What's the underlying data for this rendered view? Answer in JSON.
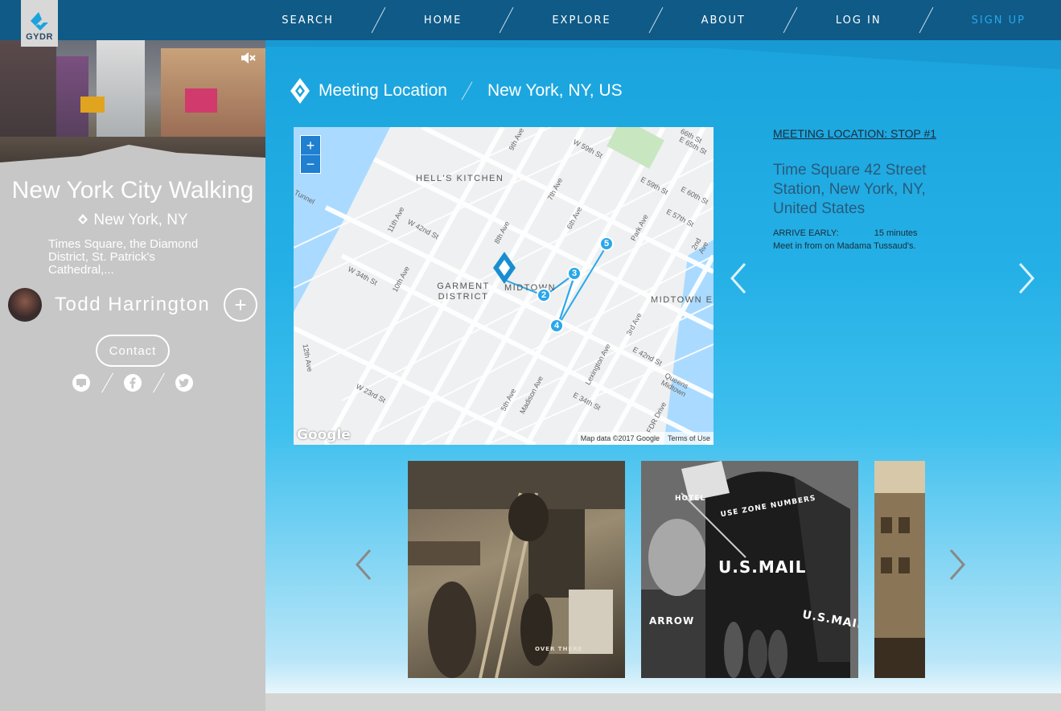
{
  "nav": {
    "logo_text": "GYDR",
    "items": [
      "SEARCH",
      "HOME",
      "EXPLORE",
      "ABOUT",
      "LOG IN",
      "SIGN UP"
    ]
  },
  "tour": {
    "title": "New York City Walking",
    "location": "New York, NY",
    "description": "Times Square, the Diamond District, St. Patrick's Cathedral,...",
    "guide_name": "Todd Harrington",
    "add_label": "+",
    "contact_label": "Contact"
  },
  "breadcrumb": {
    "section": "Meeting Location",
    "place": "New York, NY, US"
  },
  "map": {
    "zoom_in": "+",
    "zoom_out": "−",
    "google": "Google",
    "attribution": "Map data ©2017 Google",
    "terms": "Terms of Use",
    "labels": [
      "HELL'S KITCHEN",
      "GARMENT DISTRICT",
      "MIDTOWN",
      "MIDTOWN E",
      "W 59th St",
      "W 42nd St",
      "W 34th St",
      "W 23rd St",
      "E 59th St",
      "E 60th St",
      "E 57th St",
      "E 42nd St",
      "E 34th St",
      "9th Ave",
      "8th Ave",
      "7th Ave",
      "6th Ave",
      "5th Ave",
      "10th Ave",
      "11th Ave",
      "12th Ave",
      "Park Ave",
      "Madison Ave",
      "Lexington Ave",
      "3rd Ave",
      "2nd Ave",
      "Queens Midtown",
      "FDR Drive",
      "Tunnel",
      "66th St",
      "E 65th St"
    ],
    "markers": [
      "2",
      "3",
      "4",
      "5"
    ]
  },
  "stop": {
    "label": "MEETING LOCATION: STOP #1",
    "address": "Time Square 42 Street Station, New York, NY, United States",
    "arrive_label": "ARRIVE EARLY:",
    "arrive_value": "15 minutes",
    "meet_text": "Meet in from on Madama Tussaud's."
  },
  "photos": {
    "photo2_text1": "USE ZONE NUMBERS",
    "photo2_text2": "U.S.MAIL",
    "photo2_text3": "ARROW",
    "photo2_text4": "HOTEL",
    "photo1_text": "OVER THERE"
  },
  "colors": {
    "nav_bg": "#0f5a87",
    "accent": "#2aa7ea",
    "route": "#2aa7ea"
  }
}
